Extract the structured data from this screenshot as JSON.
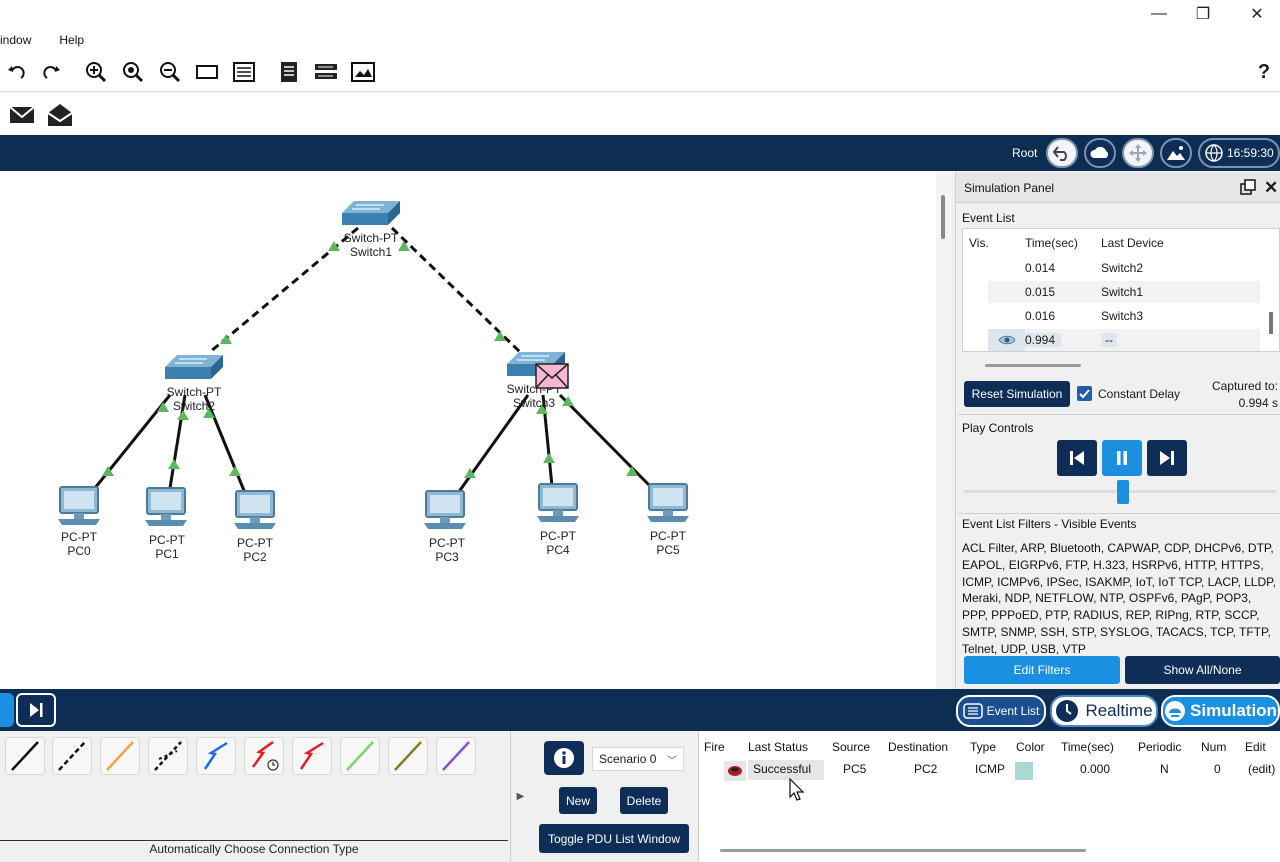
{
  "menu": {
    "items": [
      "indow",
      "Help"
    ]
  },
  "window": {
    "minimize": "—",
    "maximize": "❐",
    "close": "✕"
  },
  "toolbar": {
    "help": "?"
  },
  "navbar": {
    "root_label": "Root",
    "clock": "16:59:30"
  },
  "topology": {
    "switches": [
      {
        "model": "Switch-PT",
        "name": "Switch1"
      },
      {
        "model": "Switch-PT",
        "name": "Switch2"
      },
      {
        "model": "Switch-PT",
        "name": "Switch3"
      }
    ],
    "pcs": [
      {
        "model": "PC-PT",
        "name": "PC0"
      },
      {
        "model": "PC-PT",
        "name": "PC1"
      },
      {
        "model": "PC-PT",
        "name": "PC2"
      },
      {
        "model": "PC-PT",
        "name": "PC3"
      },
      {
        "model": "PC-PT",
        "name": "PC4"
      },
      {
        "model": "PC-PT",
        "name": "PC5"
      }
    ]
  },
  "sim_panel": {
    "title": "Simulation Panel",
    "event_list_label": "Event List",
    "columns": [
      "Vis.",
      "Time(sec)",
      "Last Device"
    ],
    "events": [
      {
        "time": "0.014",
        "device": "Switch2"
      },
      {
        "time": "0.015",
        "device": "Switch1"
      },
      {
        "time": "0.016",
        "device": "Switch3"
      },
      {
        "time": "0.994",
        "device": "--"
      }
    ],
    "reset_label": "Reset Simulation",
    "constant_delay_label": "Constant Delay",
    "captured_label": "Captured to:",
    "captured_value": "0.994 s",
    "play_controls_label": "Play Controls",
    "filters_label": "Event List Filters - Visible Events",
    "filters_text": "ACL Filter, ARP, Bluetooth, CAPWAP, CDP, DHCPv6, DTP, EAPOL, EIGRPv6, FTP, H.323, HSRPv6, HTTP, HTTPS, ICMP, ICMPv6, IPSec, ISAKMP, IoT, IoT TCP, LACP, LLDP, Meraki, NDP, NETFLOW, NTP, OSPFv6, PAgP, POP3, PPP, PPPoED, PTP, RADIUS, REP, RIPng, RTP, SCCP, SMTP, SNMP, SSH, STP, SYSLOG, TACACS, TCP, TFTP, Telnet, UDP, USB, VTP",
    "edit_filters_label": "Edit Filters",
    "show_all_label": "Show All/None"
  },
  "modes": {
    "event_list": "Event List",
    "realtime": "Realtime",
    "simulation": "Simulation"
  },
  "connections": {
    "status_text": "Automatically Choose Connection Type"
  },
  "scenario": {
    "selected": "Scenario 0",
    "new_label": "New",
    "delete_label": "Delete",
    "toggle_label": "Toggle PDU List Window"
  },
  "pdu_list": {
    "columns": [
      "Fire",
      "Last Status",
      "Source",
      "Destination",
      "Type",
      "Color",
      "Time(sec)",
      "Periodic",
      "Num",
      "Edit"
    ],
    "rows": [
      {
        "status": "Successful",
        "source": "PC5",
        "destination": "PC2",
        "type": "ICMP",
        "color": "#a9d9d4",
        "time": "0.000",
        "periodic": "N",
        "num": "0",
        "edit": "(edit)"
      }
    ]
  }
}
